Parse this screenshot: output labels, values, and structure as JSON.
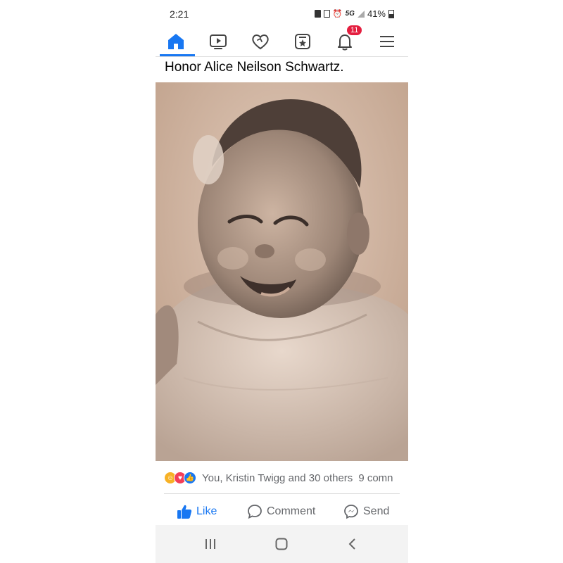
{
  "status_bar": {
    "time": "2:21",
    "network": "5G",
    "battery": "41%"
  },
  "nav": {
    "items": [
      {
        "name": "home",
        "active": true
      },
      {
        "name": "watch"
      },
      {
        "name": "dating"
      },
      {
        "name": "marketplace"
      },
      {
        "name": "notifications",
        "badge": "11"
      },
      {
        "name": "menu"
      }
    ],
    "accent": "#1877f2",
    "badge_color": "#e41e3f"
  },
  "post": {
    "text": "Honor Alice Neilson Schwartz.",
    "photo": {
      "kind": "vintage sepia baby portrait"
    },
    "reactions": {
      "icons": [
        "care",
        "love",
        "like"
      ],
      "summary": "You, Kristin Twigg and 30 others",
      "comments": "9 comn"
    },
    "actions": {
      "like": "Like",
      "comment": "Comment",
      "send": "Send"
    }
  }
}
